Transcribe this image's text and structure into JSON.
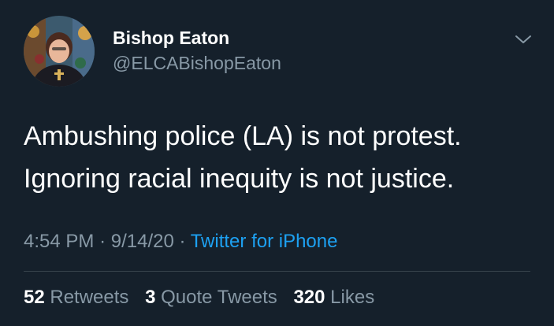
{
  "colors": {
    "background": "#15202b",
    "primary_text": "#ffffff",
    "secondary_text": "#8899a6",
    "link": "#1da1f2",
    "divider": "#38444d"
  },
  "header": {
    "avatar_icon": "profile-photo",
    "display_name": "Bishop Eaton",
    "handle": "@ELCABishopEaton",
    "menu_icon": "chevron-down-icon"
  },
  "tweet": {
    "lines": [
      "Ambushing police (LA) is not protest.",
      "Ignoring racial inequity is not justice."
    ]
  },
  "meta": {
    "time": "4:54 PM",
    "separator": "·",
    "date": "9/14/20",
    "source": "Twitter for iPhone"
  },
  "stats": {
    "retweets_count": "52",
    "retweets_label": "Retweets",
    "quotes_count": "3",
    "quotes_label": "Quote Tweets",
    "likes_count": "320",
    "likes_label": "Likes"
  }
}
